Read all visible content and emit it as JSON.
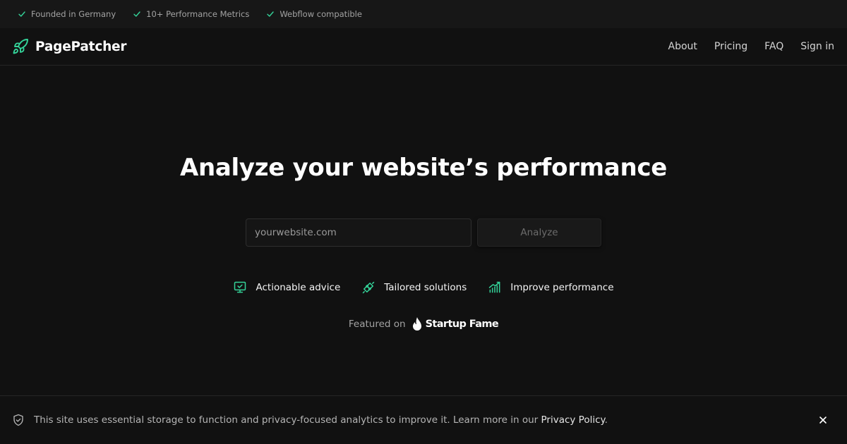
{
  "topbar": {
    "items": [
      {
        "label": "Founded in Germany"
      },
      {
        "label": "10+ Performance Metrics"
      },
      {
        "label": "Webflow compatible"
      }
    ]
  },
  "header": {
    "brand": "PagePatcher",
    "nav": [
      {
        "label": "About"
      },
      {
        "label": "Pricing"
      },
      {
        "label": "FAQ"
      },
      {
        "label": "Sign in"
      }
    ]
  },
  "hero": {
    "title": "Analyze your website’s performance",
    "search": {
      "placeholder": "yourwebsite.com",
      "value": ""
    },
    "button_label": "Analyze"
  },
  "features": [
    {
      "label": "Actionable advice",
      "icon": "monitor-check-icon"
    },
    {
      "label": "Tailored solutions",
      "icon": "plug-icon"
    },
    {
      "label": "Improve performance",
      "icon": "chart-trend-icon"
    }
  ],
  "featured": {
    "label": "Featured on",
    "brand": "Startup Fame"
  },
  "cookie": {
    "text": "This site uses essential storage to function and privacy-focused analytics to improve it. Learn more in our ",
    "link_label": "Privacy Policy",
    "suffix": "."
  },
  "colors": {
    "accent": "#34d399",
    "background": "#111111",
    "topbar": "#171717"
  }
}
